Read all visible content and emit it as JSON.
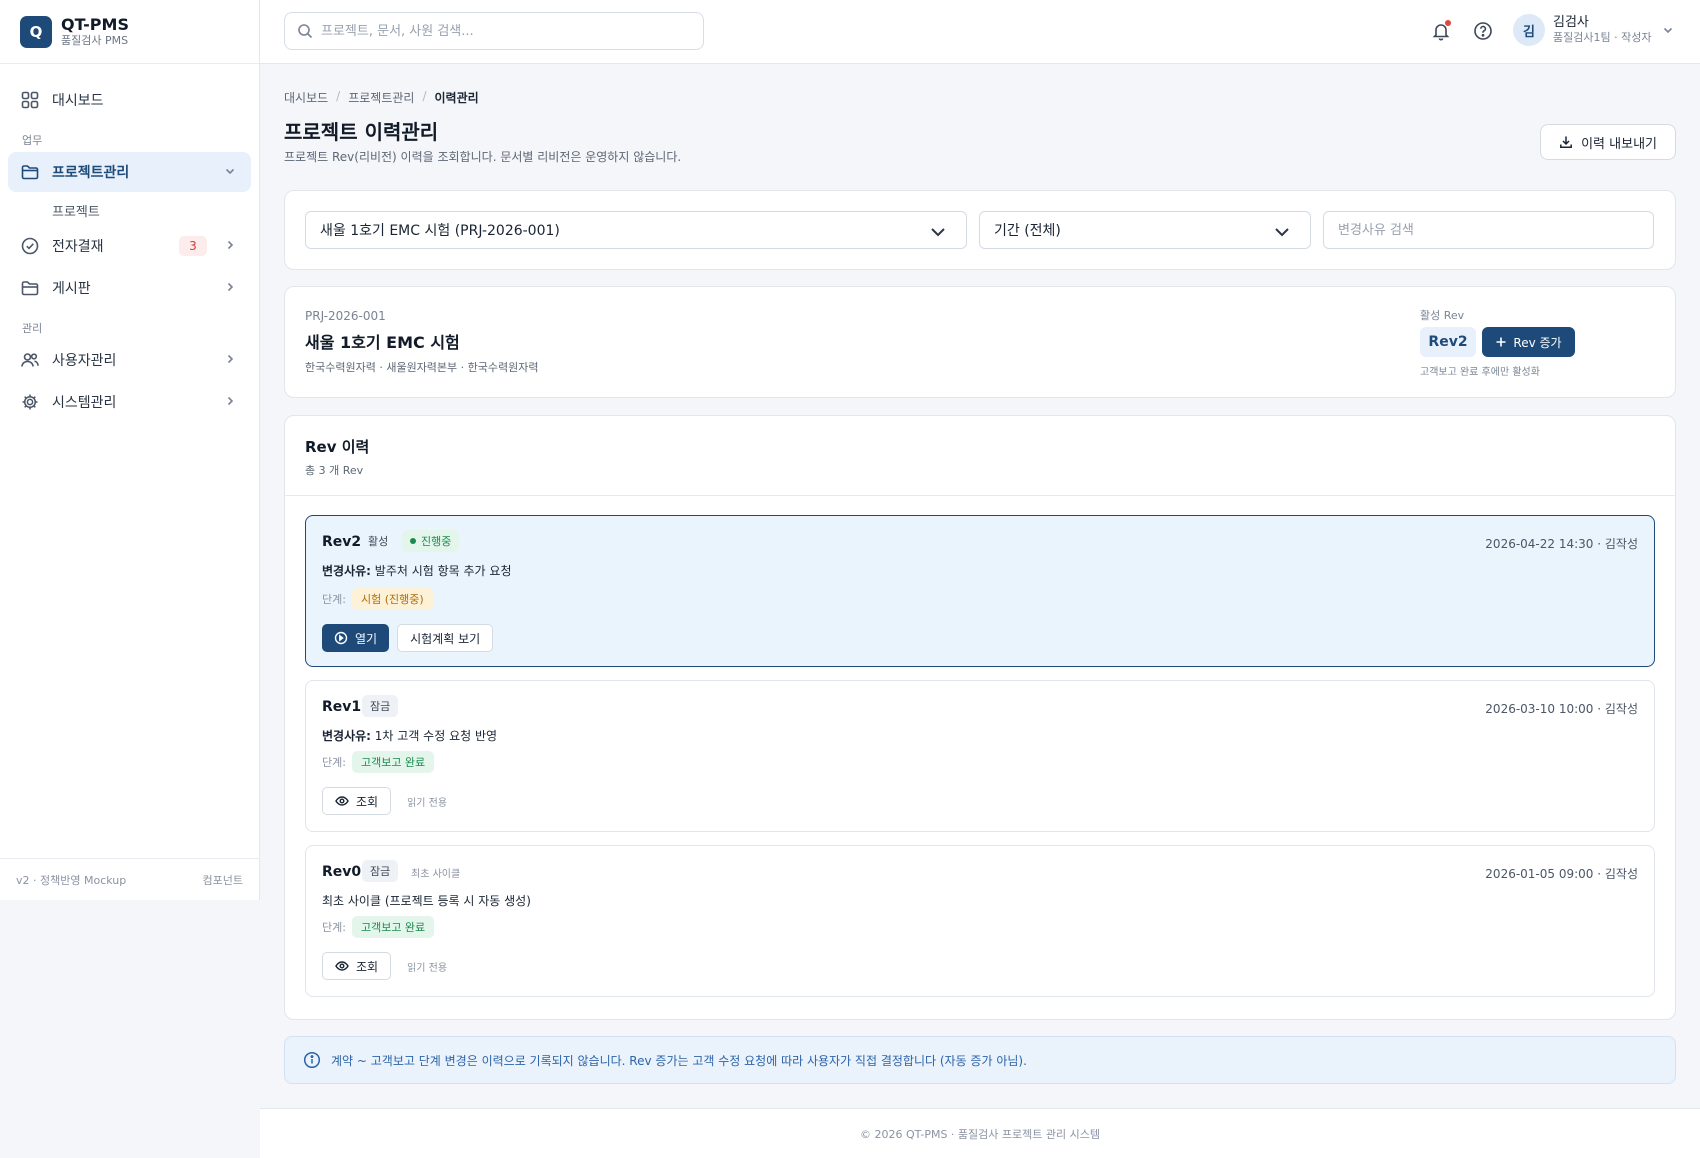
{
  "brand": {
    "logo_letter": "Q",
    "name": "QT-PMS",
    "subtitle": "품질검사 PMS"
  },
  "sidebar": {
    "dashboard": "대시보드",
    "section_work": "업무",
    "project_mgmt": "프로젝트관리",
    "project_sub": "프로젝트",
    "approval": "전자결재",
    "approval_count": "3",
    "board": "게시판",
    "section_admin": "관리",
    "user_mgmt": "사용자관리",
    "system_mgmt": "시스템관리",
    "footer_version": "v2 · 정책반영 Mockup",
    "footer_link": "컴포넌트"
  },
  "topbar": {
    "search_placeholder": "프로젝트, 문서, 사원 검색...",
    "user_initial": "김",
    "user_name": "김검사",
    "user_role": "품질검사1팀 · 작성자"
  },
  "breadcrumb": {
    "home": "대시보드",
    "parent": "프로젝트관리",
    "current": "이력관리"
  },
  "page": {
    "title": "프로젝트 이력관리",
    "description": "프로젝트 Rev(리비전) 이력을 조회합니다. 문서별 리비전은 운영하지 않습니다.",
    "export_label": "이력 내보내기"
  },
  "filters": {
    "project_select": "새울 1호기 EMC 시험 (PRJ-2026-001)",
    "period_select": "기간 (전체)",
    "reason_placeholder": "변경사유 검색"
  },
  "project": {
    "code": "PRJ-2026-001",
    "name": "새울 1호기 EMC 시험",
    "org": "한국수력원자력 · 새울원자력본부 · 한국수력원자력",
    "active_rev_label": "활성 Rev",
    "active_rev": "Rev2",
    "rev_add_label": "Rev 증가",
    "rev_hint": "고객보고 완료 후에만 활성화"
  },
  "history": {
    "title": "Rev 이력",
    "count": "총 3 개 Rev",
    "stage_label": "단계:",
    "reason_label": "변경사유:",
    "items": [
      {
        "rev": "Rev2",
        "tag": "활성",
        "status": "진행중",
        "meta": "2026-04-22 14:30 · 김작성",
        "reason": "발주처 시험 항목 추가 요청",
        "stage": "시험 (진행중)",
        "btn_open": "열기",
        "btn_plan": "시험계획 보기"
      },
      {
        "rev": "Rev1",
        "tag": "잠금",
        "meta": "2026-03-10 10:00 · 김작성",
        "reason": "1차 고객 수정 요청 반영",
        "stage": "고객보고 완료",
        "btn_view": "조회",
        "readonly": "읽기 전용"
      },
      {
        "rev": "Rev0",
        "tag": "잠금",
        "note": "최초 사이클",
        "meta": "2026-01-05 09:00 · 김작성",
        "reason": "최초 사이클 (프로젝트 등록 시 자동 생성)",
        "stage": "고객보고 완료",
        "btn_view": "조회",
        "readonly": "읽기 전용"
      }
    ]
  },
  "info": "계약 ~ 고객보고 단계 변경은 이력으로 기록되지 않습니다. Rev 증가는 고객 수정 요청에 따라 사용자가 직접 결정합니다 (자동 증가 아님).",
  "footer": "© 2026 QT-PMS · 품질검사 프로젝트 관리 시스템",
  "colors": {
    "primary": "#1e4a7a",
    "accent_bg": "#eaf4fd",
    "success": "#1c8a4f",
    "warning": "#b06d07",
    "danger": "#d23b3b"
  }
}
